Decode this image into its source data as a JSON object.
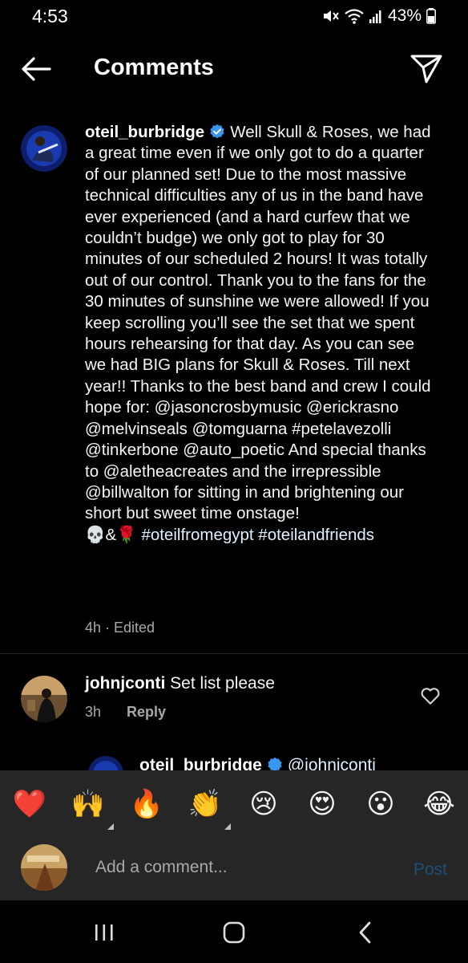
{
  "status": {
    "time": "4:53",
    "battery": "43%"
  },
  "header": {
    "title": "Comments"
  },
  "caption": {
    "username": "oteil_burbridge",
    "text": "Well Skull & Roses, we had a great time even if we only got to do a quarter of our planned set! Due to the most massive technical difficulties any of us in the band have ever experienced (and a hard curfew that we couldn’t budge) we only got to play for 30 minutes of our scheduled 2 hours! It was totally out of our control. Thank you to the fans for the 30 minutes of sunshine we were allowed! If you keep scrolling you’ll see the set that we spent hours rehearsing for that day. As you can see we had BIG plans for Skull & Roses. Till next year!! Thanks to the best band and crew I could hope for: @jasoncrosbymusic @erickrasno @melvinseals @tomguarna #petelavezolli @tinkerbone @auto_poetic And special thanks to @aletheacreates and the irrepressible @billwalton for sitting in and brightening our short but sweet time onstage!",
    "emoji_line": "💀&🌹",
    "tags": "#oteilfromegypt #oteilandfriends",
    "meta": "4h · Edited"
  },
  "reply": {
    "username": "johnjconti",
    "text": "Set list please",
    "time": "3h",
    "reply_label": "Reply"
  },
  "nested_reply": {
    "username": "oteil_burbridge",
    "mention": "@johnjconti"
  },
  "emoji_bar": [
    "❤️",
    "🙌",
    "🔥",
    "👏",
    "😢",
    "😍",
    "😮",
    "😂"
  ],
  "composer": {
    "placeholder": "Add a comment...",
    "post_label": "Post"
  },
  "colors": {
    "background": "#000000",
    "panel": "#262626",
    "verified": "#3897f0",
    "post_disabled": "#1d4f7d"
  }
}
